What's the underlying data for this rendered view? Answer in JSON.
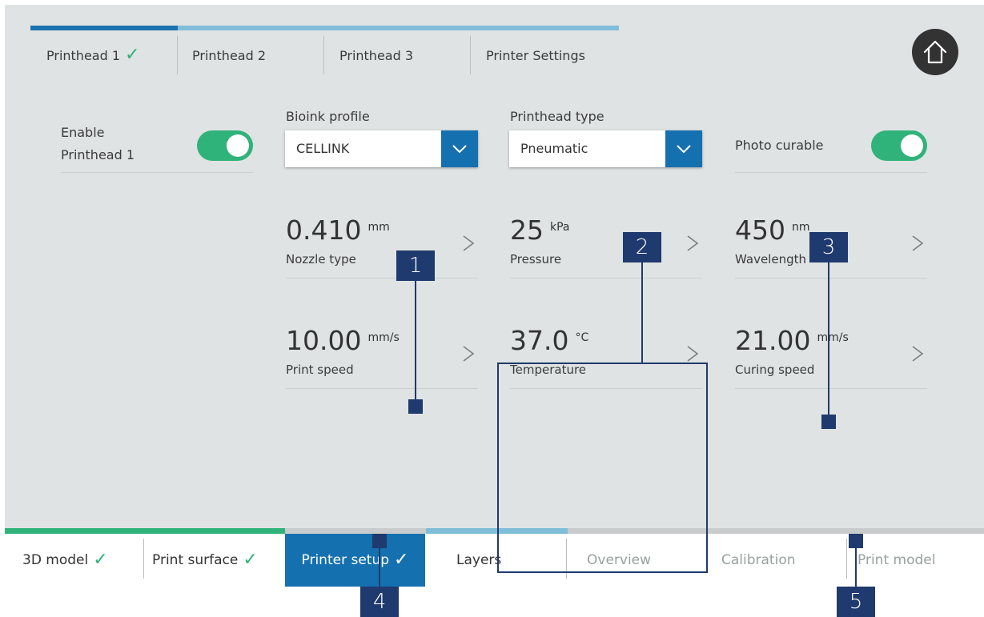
{
  "tabs": [
    {
      "label": "Printhead 1",
      "done": true
    },
    {
      "label": "Printhead 2",
      "done": false
    },
    {
      "label": "Printhead 3",
      "done": false
    },
    {
      "label": "Printer Settings",
      "done": false
    }
  ],
  "check_glyph": "✓",
  "enable": {
    "label_line1": "Enable",
    "label_line2": "Printhead 1",
    "on": true
  },
  "bioink": {
    "label": "Bioink profile",
    "value": "CELLINK"
  },
  "printhead_type": {
    "label": "Printhead type",
    "value": "Pneumatic"
  },
  "photo_curable": {
    "label": "Photo curable",
    "on": true
  },
  "params": [
    {
      "value": "0.410",
      "unit": "mm",
      "label": "Nozzle type"
    },
    {
      "value": "25",
      "unit": "kPa",
      "label": "Pressure"
    },
    {
      "value": "450",
      "unit": "nm",
      "label": "Wavelength"
    },
    {
      "value": "10.00",
      "unit": "mm/s",
      "label": "Print speed"
    },
    {
      "value": "37.0",
      "unit": "°C",
      "label": "Temperature"
    },
    {
      "value": "21.00",
      "unit": "mm/s",
      "label": "Curing speed"
    }
  ],
  "steps": [
    {
      "label": "3D model",
      "done": true,
      "state": "done"
    },
    {
      "label": "Print surface",
      "done": true,
      "state": "done"
    },
    {
      "label": "Printer setup",
      "done": true,
      "state": "active"
    },
    {
      "label": "Layers",
      "done": false,
      "state": "current"
    },
    {
      "label": "Overview",
      "done": false,
      "state": "inactive"
    },
    {
      "label": "Calibration",
      "done": false,
      "state": "inactive"
    },
    {
      "label": "Print model",
      "done": false,
      "state": "inactive"
    }
  ],
  "annotations": [
    "1",
    "2",
    "3",
    "4",
    "5"
  ],
  "icons": {
    "home": "home-icon",
    "chevron_down": "chevron-down-icon",
    "chevron_right": "chevron-right-icon",
    "check": "check-icon"
  },
  "colors": {
    "accent": "#1570b0",
    "success": "#2fb37a",
    "panel": "#dfe3e3",
    "annotation": "#1f3a6e"
  }
}
